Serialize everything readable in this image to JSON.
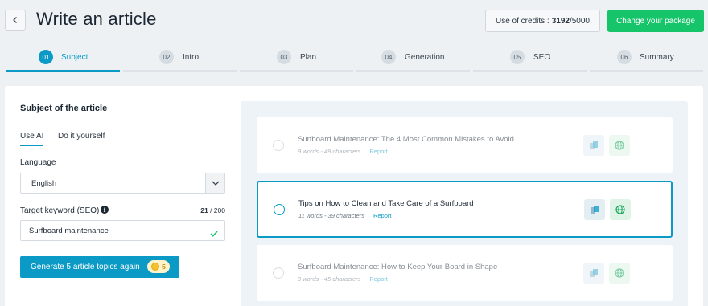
{
  "header": {
    "title": "Write an article",
    "credits_label": "Use of credits :",
    "credits_used": "3192",
    "credits_total": "/5000",
    "change_package_label": "Change your package"
  },
  "steps": [
    {
      "num": "01",
      "label": "Subject",
      "active": true
    },
    {
      "num": "02",
      "label": "Intro",
      "active": false
    },
    {
      "num": "03",
      "label": "Plan",
      "active": false
    },
    {
      "num": "04",
      "label": "Generation",
      "active": false
    },
    {
      "num": "05",
      "label": "SEO",
      "active": false
    },
    {
      "num": "06",
      "label": "Summary",
      "active": false
    }
  ],
  "subject": {
    "section_title": "Subject of the article",
    "tabs": [
      {
        "label": "Use AI",
        "active": true
      },
      {
        "label": "Do it yourself",
        "active": false
      }
    ],
    "language_label": "Language",
    "language_value": "English",
    "keyword_label": "Target keyword (SEO)",
    "keyword_count": "21",
    "keyword_max": " / 200",
    "keyword_value": "Surfboard maintenance",
    "generate_label": "Generate 5 article topics again",
    "generate_cost": "5"
  },
  "topics": [
    {
      "title": "Surfboard Maintenance: The 4 Most Common Mistakes to Avoid",
      "meta": "9 words - 49 characters",
      "report": "Report",
      "state": "dim"
    },
    {
      "title": "Tips on How to Clean and Take Care of a Surfboard",
      "meta": "11 words - 39 characters",
      "report": "Report",
      "state": "selected"
    },
    {
      "title": "Surfboard Maintenance: How to Keep Your Board in Shape",
      "meta": "9 words - 45 characters",
      "report": "Report",
      "state": "dim"
    }
  ],
  "icons": {
    "back": "chevron-left-icon",
    "select_arrow": "chevron-down-icon",
    "info": "info-icon",
    "valid": "check-icon",
    "coin": "coin-icon",
    "copy": "copy-icon",
    "globe": "globe-icon"
  },
  "colors": {
    "accent": "#0b9ac6",
    "success": "#16c46a",
    "background": "#edf1f4"
  }
}
